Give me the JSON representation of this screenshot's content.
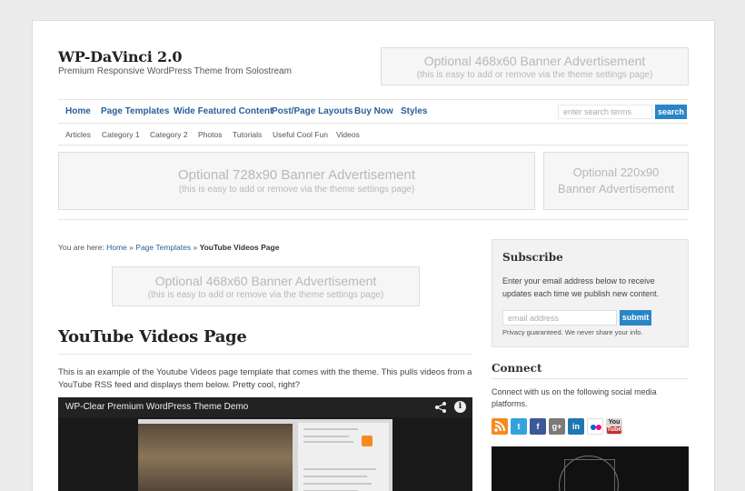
{
  "header": {
    "site_title": "WP-DaVinci 2.0",
    "tagline": "Premium Responsive WordPress Theme from Solostream"
  },
  "header_ad": {
    "title": "Optional 468x60 Banner Advertisement",
    "subtitle": "(this is easy to add or remove via the theme settings page)"
  },
  "nav": {
    "items": [
      {
        "label": "Home"
      },
      {
        "label": "Page Templates"
      },
      {
        "label": "Wide Featured Content"
      },
      {
        "label": "Post/Page Layouts"
      },
      {
        "label": "Buy Now"
      },
      {
        "label": "Styles"
      }
    ],
    "search_placeholder": "enter search terms",
    "search_button": "search"
  },
  "subnav": {
    "items": [
      {
        "label": "Articles"
      },
      {
        "label": "Category 1"
      },
      {
        "label": "Category 2"
      },
      {
        "label": "Photos"
      },
      {
        "label": "Tutorials"
      },
      {
        "label": "Useful Cool Fun"
      },
      {
        "label": "Videos"
      }
    ]
  },
  "ad_728": {
    "title": "Optional 728x90 Banner Advertisement",
    "subtitle": "(this is easy to add or remove via the theme settings page)"
  },
  "ad_220": {
    "line1": "Optional 220x90",
    "line2": "Banner Advertisement"
  },
  "breadcrumb": {
    "prefix": "You are here:",
    "home": "Home",
    "sep": "»",
    "parent": "Page Templates",
    "current": "YouTube Videos Page"
  },
  "content_ad": {
    "title": "Optional 468x60 Banner Advertisement",
    "subtitle": "(this is easy to add or remove via the theme settings page)"
  },
  "content": {
    "title": "YouTube Videos Page",
    "intro": "This is an example of the Youtube Videos page template that comes with the theme. This pulls videos from a YouTube RSS feed and displays them below. Pretty cool, right?"
  },
  "video": {
    "title": "WP-Clear Premium WordPress Theme Demo",
    "info_glyph": "i"
  },
  "subscribe": {
    "title": "Subscribe",
    "text": "Enter your email address below to receive updates each time we publish new content.",
    "placeholder": "email address",
    "button": "submit",
    "privacy": "Privacy guaranteed. We never share your info."
  },
  "connect": {
    "title": "Connect",
    "text": "Connect with us on the following social media platforms.",
    "icons": [
      {
        "name": "rss-icon",
        "glyph": "",
        "color": "#f58b1f"
      },
      {
        "name": "twitter-icon",
        "glyph": "t",
        "color": "#33a3dc"
      },
      {
        "name": "facebook-icon",
        "glyph": "f",
        "color": "#3b5998"
      },
      {
        "name": "googleplus-icon",
        "glyph": "g+",
        "color": "#7a7a7a"
      },
      {
        "name": "linkedin-icon",
        "glyph": "in",
        "color": "#1f78b4"
      },
      {
        "name": "flickr-icon",
        "glyph": "••",
        "color": "#ffffff"
      },
      {
        "name": "youtube-icon",
        "glyph": "You",
        "color": "#d9d9d9"
      }
    ]
  }
}
